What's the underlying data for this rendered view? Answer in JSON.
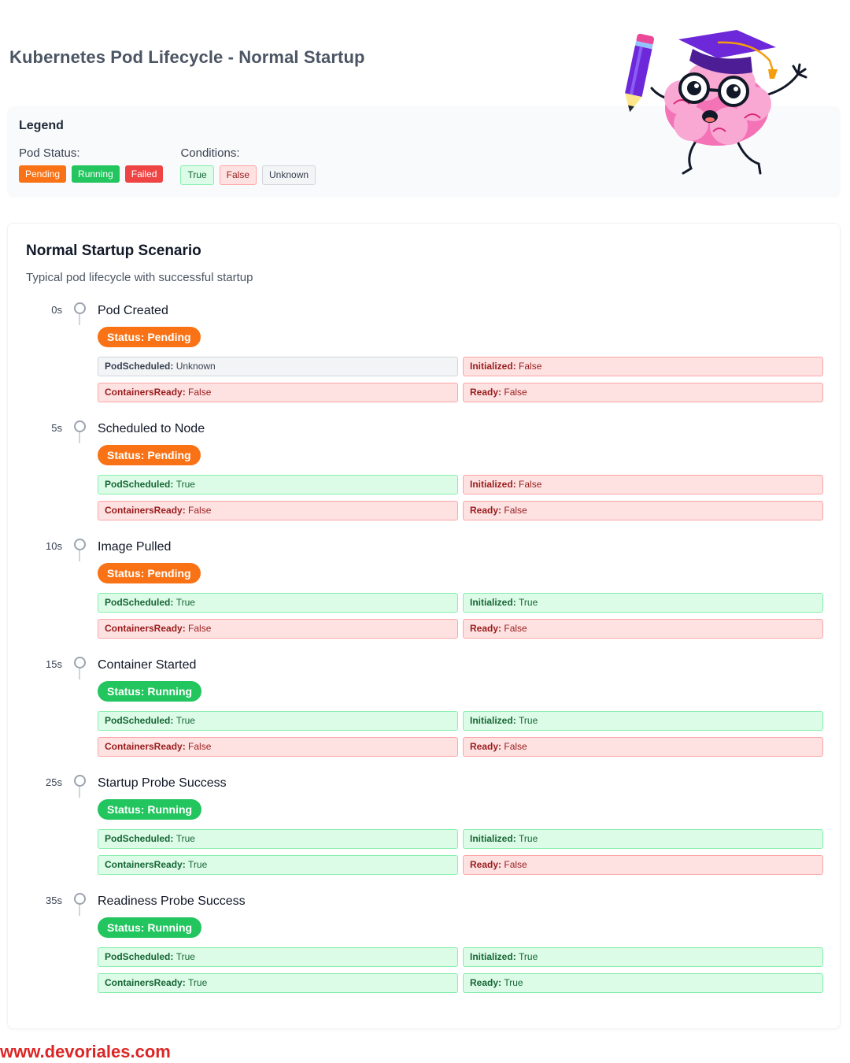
{
  "title": "Kubernetes Pod Lifecycle - Normal Startup",
  "legend": {
    "title": "Legend",
    "pod_status_label": "Pod Status:",
    "pod_statuses": [
      "Pending",
      "Running",
      "Failed"
    ],
    "conditions_label": "Conditions:",
    "conditions": [
      "True",
      "False",
      "Unknown"
    ]
  },
  "colors": {
    "pending": "#f97316",
    "running": "#22c55e",
    "failed": "#ef4444",
    "true_bg": "#dcfce7",
    "true_border": "#86efac",
    "true_text": "#166534",
    "false_bg": "#fee2e2",
    "false_border": "#fca5a5",
    "false_text": "#991b1b",
    "unknown_bg": "#f3f4f6",
    "unknown_border": "#d1d5db",
    "unknown_text": "#374151",
    "footer": "#dc2626"
  },
  "scenario": {
    "title": "Normal Startup Scenario",
    "subtitle": "Typical pod lifecycle with successful startup",
    "steps": [
      {
        "time": "0s",
        "event": "Pod Created",
        "status": "Status: Pending",
        "conditions": [
          {
            "name": "PodScheduled",
            "sep": ": ",
            "value": "Unknown"
          },
          {
            "name": "Initialized",
            "sep": ": ",
            "value": "False"
          },
          {
            "name": "ContainersReady",
            "sep": ": ",
            "value": "False"
          },
          {
            "name": "Ready",
            "sep": ": ",
            "value": "False"
          }
        ]
      },
      {
        "time": "5s",
        "event": "Scheduled to Node",
        "status": "Status: Pending",
        "conditions": [
          {
            "name": "PodScheduled",
            "sep": ": ",
            "value": "True"
          },
          {
            "name": "Initialized",
            "sep": ": ",
            "value": "False"
          },
          {
            "name": "ContainersReady",
            "sep": ": ",
            "value": "False"
          },
          {
            "name": "Ready",
            "sep": ": ",
            "value": "False"
          }
        ]
      },
      {
        "time": "10s",
        "event": "Image Pulled",
        "status": "Status: Pending",
        "conditions": [
          {
            "name": "PodScheduled",
            "sep": ": ",
            "value": "True"
          },
          {
            "name": "Initialized",
            "sep": ": ",
            "value": "True"
          },
          {
            "name": "ContainersReady",
            "sep": ": ",
            "value": "False"
          },
          {
            "name": "Ready",
            "sep": ": ",
            "value": "False"
          }
        ]
      },
      {
        "time": "15s",
        "event": "Container Started",
        "status": "Status: Running",
        "conditions": [
          {
            "name": "PodScheduled",
            "sep": ": ",
            "value": "True"
          },
          {
            "name": "Initialized",
            "sep": ": ",
            "value": "True"
          },
          {
            "name": "ContainersReady",
            "sep": ": ",
            "value": "False"
          },
          {
            "name": "Ready",
            "sep": ": ",
            "value": "False"
          }
        ]
      },
      {
        "time": "25s",
        "event": "Startup Probe Success",
        "status": "Status: Running",
        "conditions": [
          {
            "name": "PodScheduled",
            "sep": ": ",
            "value": "True"
          },
          {
            "name": "Initialized",
            "sep": ": ",
            "value": "True"
          },
          {
            "name": "ContainersReady",
            "sep": ": ",
            "value": "True"
          },
          {
            "name": "Ready",
            "sep": ": ",
            "value": "False"
          }
        ]
      },
      {
        "time": "35s",
        "event": "Readiness Probe Success",
        "status": "Status: Running",
        "conditions": [
          {
            "name": "PodScheduled",
            "sep": ": ",
            "value": "True"
          },
          {
            "name": "Initialized",
            "sep": ": ",
            "value": "True"
          },
          {
            "name": "ContainersReady",
            "sep": ": ",
            "value": "True"
          },
          {
            "name": "Ready",
            "sep": ": ",
            "value": "True"
          }
        ]
      }
    ]
  },
  "footer": "www.devoriales.com"
}
